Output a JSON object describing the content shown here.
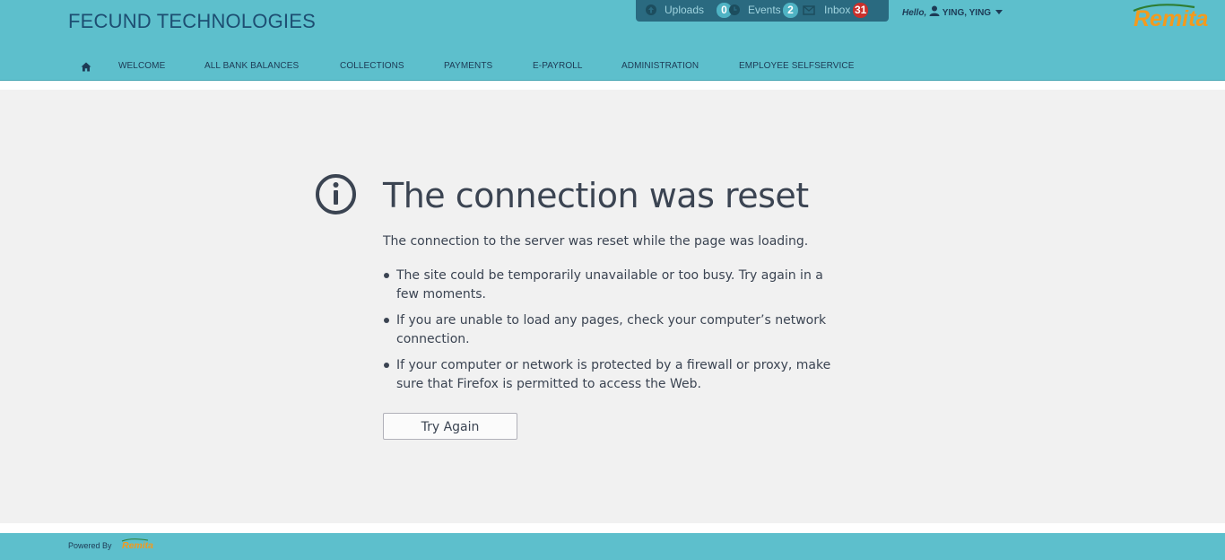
{
  "header": {
    "brand": "FECUND TECHNOLOGIES",
    "notifications": [
      {
        "label": "Uploads",
        "count": "0",
        "icon": "upload-icon",
        "color": "#4fb3c4"
      },
      {
        "label": "Events",
        "count": "2",
        "icon": "clock-icon",
        "color": "#4fb3c4"
      },
      {
        "label": "Inbox",
        "count": "31",
        "icon": "envelope-icon",
        "color": "#c9302c"
      }
    ],
    "greeting": "Hello,",
    "user_name": "YING, YING",
    "logo_text": "Remita"
  },
  "nav": {
    "home_icon": "home-icon",
    "items": [
      {
        "label": "WELCOME"
      },
      {
        "label": "ALL BANK BALANCES"
      },
      {
        "label": "COLLECTIONS"
      },
      {
        "label": "PAYMENTS"
      },
      {
        "label": "E-PAYROLL"
      },
      {
        "label": "ADMINISTRATION"
      },
      {
        "label": "EMPLOYEE SELFSERVICE"
      }
    ]
  },
  "error": {
    "icon": "info-icon",
    "title": "The connection was reset",
    "description": "The connection to the server was reset while the page was loading.",
    "tips": [
      "The site could be temporarily unavailable or too busy. Try again in a few moments.",
      "If you are unable to load any pages, check your computer’s network connection.",
      "If your computer or network is protected by a firewall or proxy, make sure that Firefox is permitted to access the Web."
    ],
    "button_label": "Try Again"
  },
  "footer": {
    "powered_by": "Powered By",
    "logo_text": "Remita"
  },
  "colors": {
    "header_bg": "#5dbfcc",
    "brand_text": "#1d4e72",
    "content_bg": "#f1f1f1",
    "text": "#3b4452",
    "logo_orange": "#f39a1d"
  }
}
